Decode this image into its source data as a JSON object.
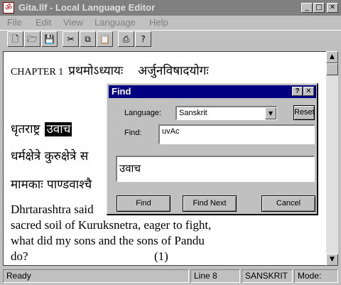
{
  "window": {
    "title": "Gita.llf - Local Language Editor",
    "icon_glyph": "ॐ",
    "controls": {
      "minimize": "_",
      "maximize": "□",
      "close": "✕"
    }
  },
  "menu": [
    "File",
    "Edit",
    "View",
    "Language",
    "Help"
  ],
  "toolbar": {
    "new": "🗋",
    "open": "🗁",
    "save": "💾",
    "cut": "✂",
    "copy": "⧉",
    "paste": "📋",
    "print": "⎙",
    "help": "?"
  },
  "document": {
    "chapter_label": "CHAPTER 1",
    "chapter_title_1": "प्रथमोऽध्यायः",
    "chapter_title_2": "अर्जुनविषादयोगः",
    "line1_before": "धृतराष्ट्र",
    "line1_highlight": "उवाच",
    "line2": "धर्मक्षेत्रे कुरुक्षेत्रे स",
    "line3": "मामकाः पाण्डवाश्चै",
    "eng1": "Dhrtarashtra said",
    "eng2": "sacred soil of Kuruksnetra, eager to fight,",
    "eng3": "what did my sons and the sons of Pandu",
    "eng4": "do?",
    "verse_no": "(1)"
  },
  "scrollbar": {
    "up": "▲",
    "down": "▼"
  },
  "status": {
    "ready": "Ready",
    "line": "Line 8",
    "language": "SANSKRIT",
    "mode": "Mode:"
  },
  "find": {
    "title": "Find",
    "help_btn": "?",
    "close_btn": "✕",
    "language_label": "Language:",
    "language_value": "Sanskrit",
    "dropdown_arrow": "▼",
    "reset": "Reset",
    "find_label": "Find:",
    "find_value": "uvAc",
    "preview": "उवाच",
    "find_btn": "Find",
    "find_next_btn": "Find Next",
    "cancel_btn": "Cancel"
  }
}
